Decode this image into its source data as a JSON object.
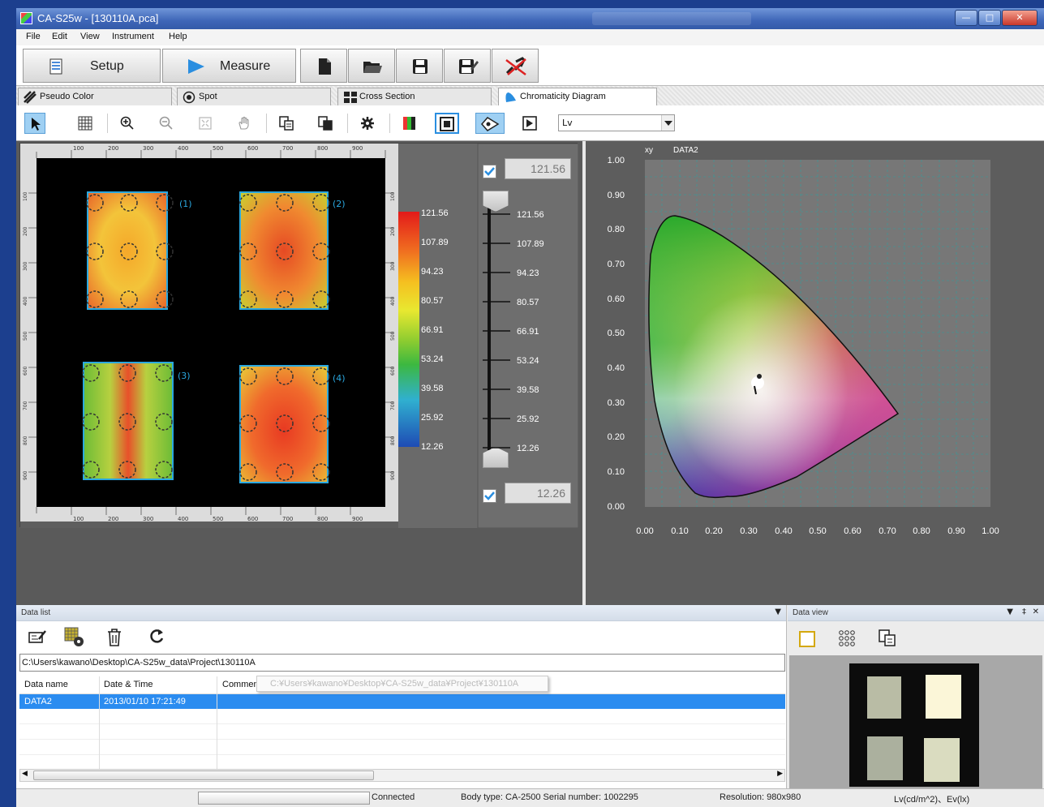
{
  "window": {
    "title": "CA-S25w - [130110A.pca]"
  },
  "menu": [
    "File",
    "Edit",
    "View",
    "Instrument",
    "Help"
  ],
  "main_buttons": {
    "setup": "Setup",
    "measure": "Measure"
  },
  "tabs": [
    {
      "label": "Pseudo Color",
      "active": false
    },
    {
      "label": "Spot",
      "active": false
    },
    {
      "label": "Cross Section",
      "active": false
    },
    {
      "label": "Chromaticity Diagram",
      "active": true
    }
  ],
  "toolbar": {
    "display_select_value": "Lv"
  },
  "scale": {
    "upper_value": "121.56",
    "lower_value": "12.26",
    "upper_checked": true,
    "lower_checked": true,
    "legend_values": [
      "121.56",
      "107.89",
      "94.23",
      "80.57",
      "66.91",
      "53.24",
      "39.58",
      "25.92",
      "12.26"
    ]
  },
  "image_ruler": {
    "x_ticks": [
      "100",
      "200",
      "300",
      "400",
      "500",
      "600",
      "700",
      "800",
      "900"
    ],
    "y_ticks": [
      "100",
      "200",
      "300",
      "400",
      "500",
      "600",
      "700",
      "800",
      "900"
    ]
  },
  "regions": [
    "(1)",
    "(2)",
    "(3)",
    "(4)"
  ],
  "chromaticity": {
    "axis_label": "xy",
    "data_label": "DATA2",
    "x_ticks": [
      "0.00",
      "0.10",
      "0.20",
      "0.30",
      "0.40",
      "0.50",
      "0.60",
      "0.70",
      "0.80",
      "0.90",
      "1.00"
    ],
    "y_ticks": [
      "1.00",
      "0.90",
      "0.80",
      "0.70",
      "0.60",
      "0.50",
      "0.40",
      "0.30",
      "0.20",
      "0.10",
      "0.00"
    ]
  },
  "data_list": {
    "title": "Data list",
    "path": "C:\\Users\\kawano\\Desktop\\CA-S25w_data\\Project\\130110A",
    "tooltip": "C:¥Users¥kawano¥Desktop¥CA-S25w_data¥Project¥130110A",
    "columns": [
      "Data name",
      "Date & Time",
      "Comment"
    ],
    "rows": [
      {
        "name": "DATA2",
        "datetime": "2013/01/10 17:21:49",
        "comment": ""
      }
    ]
  },
  "data_view": {
    "title": "Data view"
  },
  "status": {
    "connection": "Connected",
    "body": "Body type: CA-2500 Serial number: 1002295",
    "resolution": "Resolution: 980x980",
    "units": "Lv(cd/m^2)、Ev(lx)"
  },
  "colors": {
    "selection": "#2b8cf0",
    "title_bar": "#3e66b8",
    "region_border": "#2aa8e0"
  }
}
